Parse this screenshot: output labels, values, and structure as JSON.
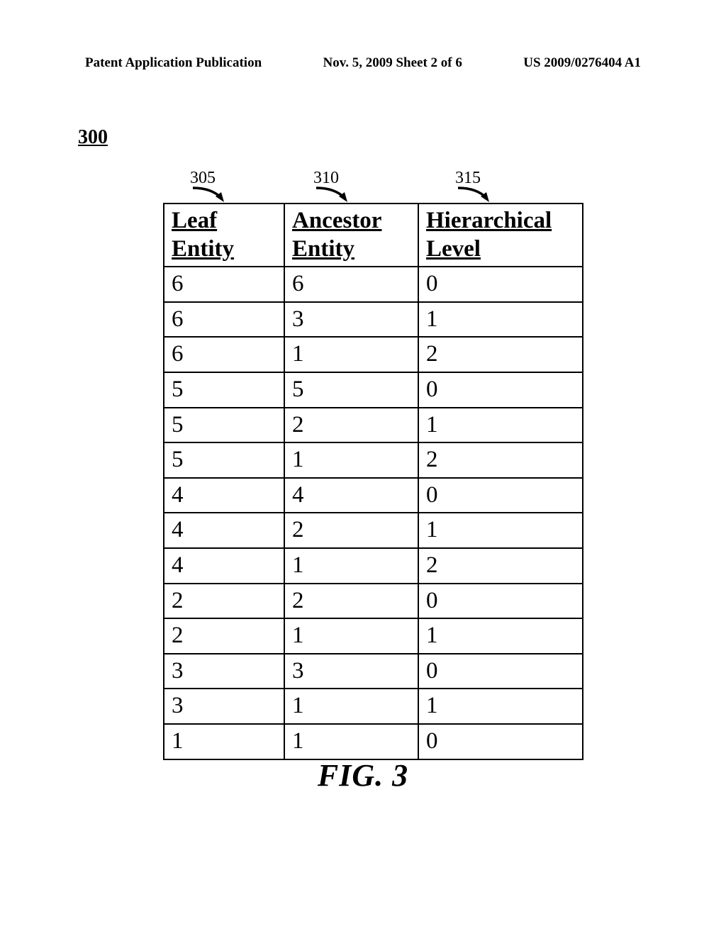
{
  "header": {
    "left": "Patent Application Publication",
    "center": "Nov. 5, 2009  Sheet 2 of 6",
    "right": "US 2009/0276404 A1"
  },
  "figure_ref": "300",
  "callouts": {
    "c1": "305",
    "c2": "310",
    "c3": "315"
  },
  "table": {
    "headers": {
      "h1": "Leaf Entity",
      "h2": "Ancestor Entity",
      "h3": "Hierarchical Level"
    },
    "rows": [
      {
        "a": "6",
        "b": "6",
        "c": "0"
      },
      {
        "a": "6",
        "b": "3",
        "c": "1"
      },
      {
        "a": "6",
        "b": "1",
        "c": "2"
      },
      {
        "a": "5",
        "b": "5",
        "c": "0"
      },
      {
        "a": "5",
        "b": "2",
        "c": "1"
      },
      {
        "a": "5",
        "b": "1",
        "c": "2"
      },
      {
        "a": "4",
        "b": "4",
        "c": "0"
      },
      {
        "a": "4",
        "b": "2",
        "c": "1"
      },
      {
        "a": "4",
        "b": "1",
        "c": "2"
      },
      {
        "a": "2",
        "b": "2",
        "c": "0"
      },
      {
        "a": "2",
        "b": "1",
        "c": "1"
      },
      {
        "a": "3",
        "b": "3",
        "c": "0"
      },
      {
        "a": "3",
        "b": "1",
        "c": "1"
      },
      {
        "a": "1",
        "b": "1",
        "c": "0"
      }
    ]
  },
  "caption": "FIG. 3"
}
